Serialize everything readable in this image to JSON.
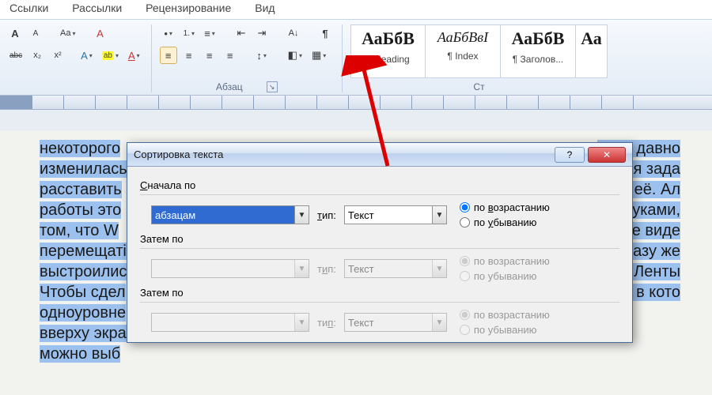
{
  "tabs": {
    "links": "Ссылки",
    "mail": "Рассылки",
    "review": "Рецензирование",
    "view": "Вид"
  },
  "ribbon": {
    "para_label": "Абзац",
    "styles_label": "Ст",
    "styles": [
      {
        "sample": "АаБбВ",
        "name": "¶ Heading"
      },
      {
        "sample": "АаБбВвІ",
        "name": "¶ Index"
      },
      {
        "sample": "АаБбВ",
        "name": "¶ Заголов..."
      },
      {
        "sample": "Аа",
        "name": ""
      }
    ]
  },
  "doc_lines": [
    "некоторого",
    "изменилась",
    "расставить",
    "работы это",
    "том, что W",
    "перемещаті",
    "выстроилис",
    "Чтобы сдел",
    "одноуровне",
    "вверху экра",
    "можно выб"
  ],
  "doc_right": [
    "льно давно",
    "ения зада",
    "нно её. Ал",
    "е руками,",
    "дете виде",
    "азу же",
    "",
    "» Ленты",
    "но, в кото"
  ],
  "dialog": {
    "title": "Сортировка текста",
    "section1": "Сначала по",
    "section2": "Затем по",
    "section3": "Затем по",
    "combo1": "абзацам",
    "type_label": "тип:",
    "type_value": "Текст",
    "radio_asc": "по возрастанию",
    "radio_desc": "по убыванию"
  }
}
